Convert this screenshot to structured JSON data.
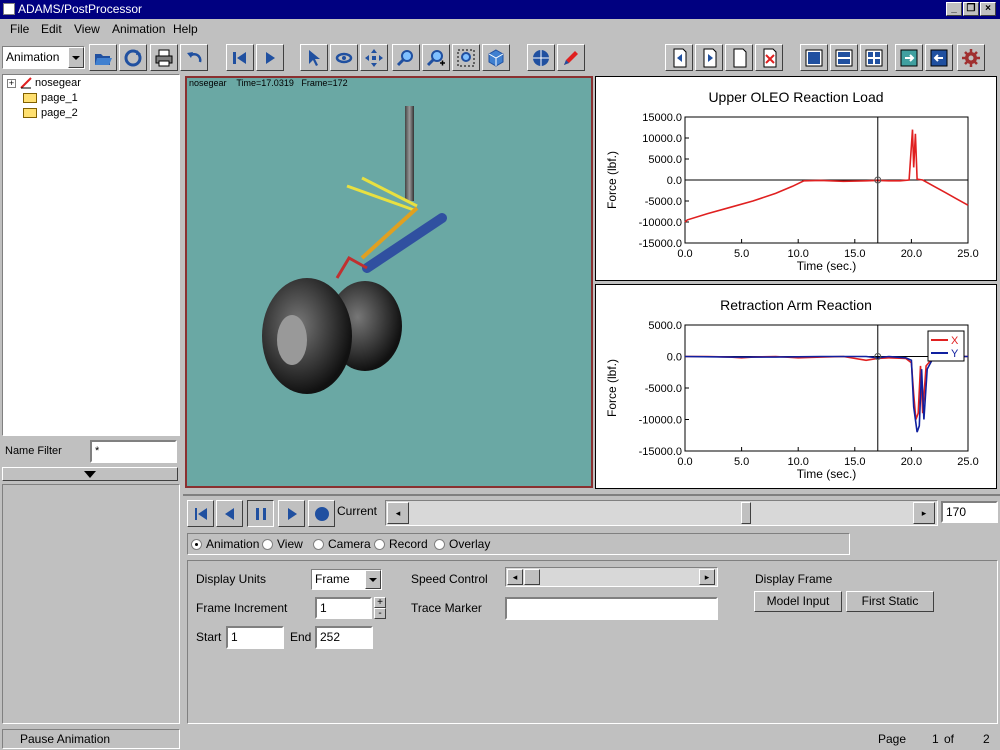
{
  "window": {
    "title": "ADAMS/PostProcessor"
  },
  "menu": [
    "File",
    "Edit",
    "View",
    "Animation",
    "Help"
  ],
  "mode_combo": {
    "value": "Animation"
  },
  "tree": {
    "root": "nosegear",
    "pages": [
      "page_1",
      "page_2"
    ]
  },
  "name_filter": {
    "label": "Name Filter",
    "value": "*"
  },
  "viewport": {
    "model": "nosegear",
    "time_label": "Time=",
    "time": "17.0319",
    "frame_label": "Frame=",
    "frame": "172"
  },
  "plot1": {
    "title": "Upper OLEO Reaction Load",
    "ylabel": "Force (lbf.)",
    "xlabel": "Time (sec.)",
    "yticks": [
      "15000.0",
      "10000.0",
      "5000.0",
      "0.0",
      "-5000.0",
      "-10000.0",
      "-15000.0"
    ],
    "xticks": [
      "0.0",
      "5.0",
      "10.0",
      "15.0",
      "20.0",
      "25.0"
    ]
  },
  "plot2": {
    "title": "Retraction Arm Reaction",
    "ylabel": "Force (lbf.)",
    "xlabel": "Time (sec.)",
    "yticks": [
      "5000.0",
      "0.0",
      "-5000.0",
      "-10000.0",
      "-15000.0"
    ],
    "xticks": [
      "0.0",
      "5.0",
      "10.0",
      "15.0",
      "20.0",
      "25.0"
    ],
    "legend": [
      "X",
      "Y"
    ]
  },
  "chart_data": [
    {
      "type": "line",
      "title": "Upper OLEO Reaction Load",
      "xlabel": "Time (sec.)",
      "ylabel": "Force (lbf.)",
      "xlim": [
        0,
        25
      ],
      "ylim": [
        -15000,
        15000
      ],
      "cursor_x": 17.03,
      "series": [
        {
          "color": "#e02020",
          "x": [
            0,
            0.2,
            2,
            4,
            6,
            8,
            9.5,
            10.5,
            12,
            14,
            16,
            17,
            18,
            19,
            19.8,
            20.1,
            20.2,
            20.35,
            20.5,
            21,
            22,
            23,
            24,
            25
          ],
          "y": [
            -10000,
            -9500,
            -8000,
            -6500,
            -5000,
            -3200,
            -1500,
            -200,
            -100,
            -300,
            -200,
            -100,
            -200,
            -200,
            0,
            12000,
            3000,
            11000,
            200,
            0,
            -1500,
            -3000,
            -4500,
            -6000
          ]
        }
      ]
    },
    {
      "type": "line",
      "title": "Retraction Arm Reaction",
      "xlabel": "Time (sec.)",
      "ylabel": "Force (lbf.)",
      "xlim": [
        0,
        25
      ],
      "ylim": [
        -15000,
        5000
      ],
      "cursor_x": 17.03,
      "series": [
        {
          "name": "X",
          "color": "#e02020",
          "x": [
            0,
            2,
            4,
            5,
            6,
            8,
            10,
            12,
            14,
            16,
            17,
            18,
            19.5,
            20,
            20.2,
            20.4,
            20.6,
            20.8,
            21,
            21.3,
            22,
            23,
            25
          ],
          "y": [
            0,
            0,
            -100,
            -200,
            -100,
            0,
            -200,
            -100,
            0,
            -600,
            -300,
            -200,
            -300,
            -1000,
            -6000,
            -10000,
            -9000,
            -1500,
            -9000,
            -1500,
            0,
            0,
            0
          ]
        },
        {
          "name": "Y",
          "color": "#1020a0",
          "x": [
            0,
            4,
            8,
            12,
            16,
            17,
            18,
            19.5,
            20,
            20.2,
            20.5,
            20.7,
            20.9,
            21.1,
            21.4,
            22,
            25
          ],
          "y": [
            0,
            -100,
            -100,
            0,
            0,
            -200,
            0,
            -200,
            -600,
            -8000,
            -12000,
            -11000,
            -2000,
            -10000,
            -2000,
            0,
            0
          ]
        }
      ]
    }
  ],
  "playback": {
    "current_label": "Current",
    "frame_value": "170"
  },
  "mode_radios": [
    "Animation",
    "View",
    "Camera",
    "Record",
    "Overlay"
  ],
  "settings": {
    "display_units_label": "Display Units",
    "display_units_value": "Frame",
    "frame_increment_label": "Frame Increment",
    "frame_increment_value": "1",
    "start_label": "Start",
    "start_value": "1",
    "end_label": "End",
    "end_value": "252",
    "speed_control_label": "Speed Control",
    "trace_marker_label": "Trace Marker",
    "display_frame_label": "Display Frame",
    "model_input_button": "Model Input",
    "first_static_button": "First Static"
  },
  "status": {
    "message": "Pause Animation",
    "page_label": "Page",
    "page": "1",
    "of_label": "of",
    "total": "2"
  }
}
